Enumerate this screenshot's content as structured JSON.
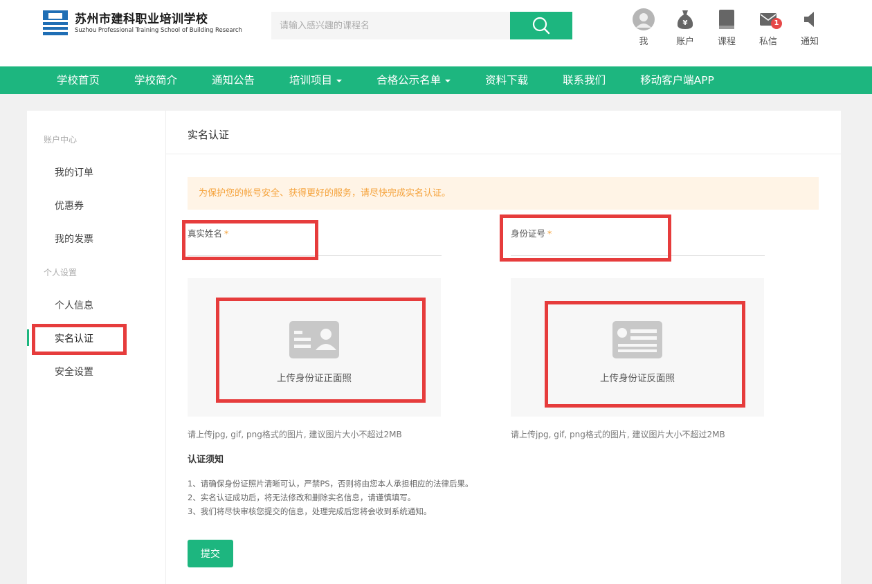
{
  "header": {
    "logo_cn": "苏州市建科职业培训学校",
    "logo_en": "Suzhou Professional Training School of Building Research",
    "search_placeholder": "请输入感兴趣的课程名",
    "user_nav": [
      {
        "label": "我",
        "icon": "avatar-icon"
      },
      {
        "label": "账户",
        "icon": "money-bag-icon"
      },
      {
        "label": "课程",
        "icon": "book-icon"
      },
      {
        "label": "私信",
        "icon": "mail-icon",
        "badge": "1"
      },
      {
        "label": "通知",
        "icon": "speaker-icon"
      }
    ]
  },
  "mainnav": {
    "items": [
      "学校首页",
      "学校简介",
      "通知公告",
      "培训项目",
      "合格公示名单",
      "资料下载",
      "联系我们",
      "移动客户端APP"
    ]
  },
  "sidebar": {
    "group_account": "账户中心",
    "orders": "我的订单",
    "coupons": "优惠券",
    "invoices": "我的发票",
    "group_personal": "个人设置",
    "profile": "个人信息",
    "realname": "实名认证",
    "security": "安全设置"
  },
  "main": {
    "title": "实名认证",
    "alert": "为保护您的帐号安全、获得更好的服务，请尽快完成实名认证。",
    "name_label": "真实姓名",
    "id_label": "身份证号",
    "required_mark": "*",
    "upload_front": "上传身份证正面照",
    "upload_back": "上传身份证反面照",
    "hint": "请上传jpg, gif, png格式的图片, 建议图片大小不超过2MB",
    "notice_title": "认证须知",
    "notice_1": "1、请确保身份证照片清晰可认，严禁PS，否则将由您本人承担相应的法律后果。",
    "notice_2": "2、实名认证成功后，将无法修改和删除实名信息，请谨慎填写。",
    "notice_3": "3、我们将尽快审核您提交的信息，处理完成后您将会收到系统通知。",
    "submit": "提交"
  },
  "colors": {
    "brand_green": "#1db67f",
    "alert_text": "#f5a23a",
    "alert_bg": "#fff4e6",
    "annotation_red": "#e63c3c",
    "badge_red": "#e64848"
  }
}
